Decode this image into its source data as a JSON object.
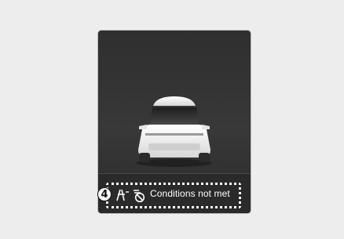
{
  "callout": {
    "number": "4"
  },
  "status": {
    "text": "Conditions not met",
    "icons": [
      "lane-assist-icon",
      "highway-driving-disabled-icon"
    ]
  },
  "colors": {
    "background": "#ededed",
    "panel": "#333333",
    "text": "#ffffff",
    "car_body": "#f2f2f2"
  }
}
